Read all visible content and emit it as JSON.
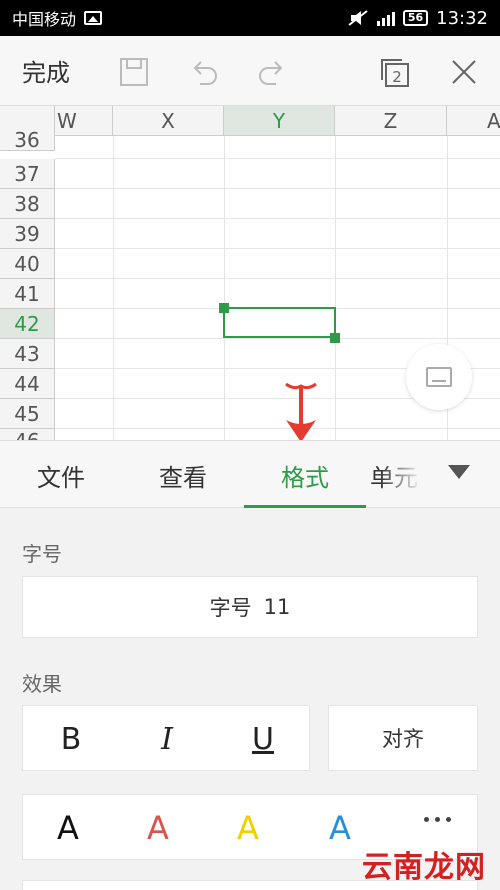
{
  "status_bar": {
    "carrier": "中国移动",
    "battery": "56",
    "time": "13:32"
  },
  "toolbar": {
    "done_label": "完成",
    "window_count": "2"
  },
  "sheet": {
    "columns": [
      "W",
      "X",
      "Y",
      "Z",
      "A"
    ],
    "selected_column": "Y",
    "rows": [
      "36",
      "37",
      "38",
      "39",
      "40",
      "41",
      "42",
      "43",
      "44",
      "45",
      "46"
    ],
    "selected_row": "42"
  },
  "tabs": [
    {
      "label": "文件"
    },
    {
      "label": "查看"
    },
    {
      "label": "格式"
    },
    {
      "label": "单元"
    }
  ],
  "active_tab": "格式",
  "panel": {
    "font_size_label": "字号",
    "font_size_button_label": "字号",
    "font_size_value": "11",
    "effects_label": "效果",
    "bold": "B",
    "italic": "I",
    "underline": "U",
    "align_label": "对齐",
    "color_glyph": "A"
  },
  "colors": {
    "accent": "#2e9a4a",
    "arrow": "#e53a2f",
    "font_colors": [
      "#111111",
      "#d9534f",
      "#f0d000",
      "#2a8fd6"
    ]
  },
  "watermark": "云南龙网"
}
